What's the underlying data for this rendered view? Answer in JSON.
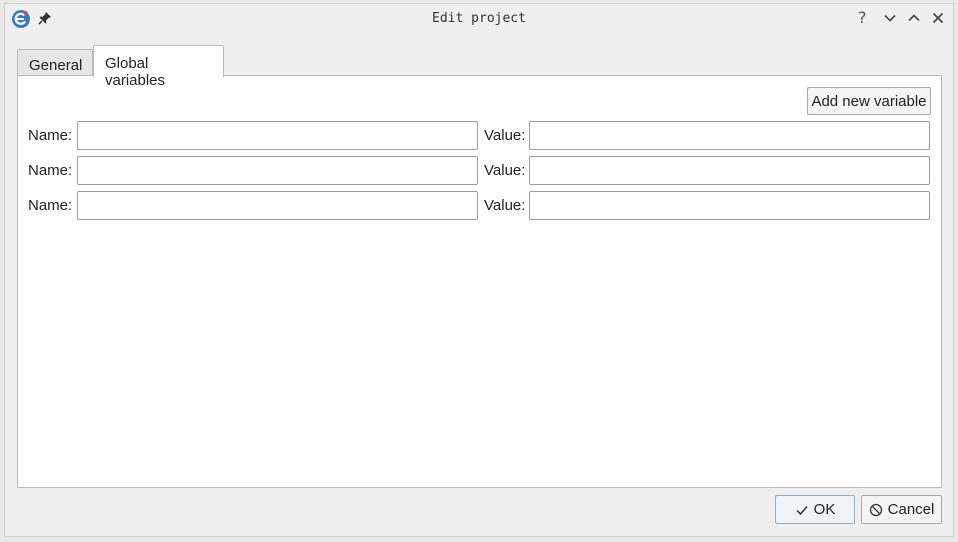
{
  "window": {
    "title": "Edit project",
    "help_label": "?"
  },
  "tabs": [
    {
      "label": "General"
    },
    {
      "label": "Global variables"
    }
  ],
  "global_variables": {
    "add_button_label": "Add new variable",
    "name_label": "Name:",
    "value_label": "Value:",
    "rows": [
      {
        "name": "",
        "value": ""
      },
      {
        "name": "",
        "value": ""
      },
      {
        "name": "",
        "value": ""
      }
    ]
  },
  "footer": {
    "ok_label": "OK",
    "cancel_label": "Cancel"
  },
  "colors": {
    "app_icon_blue": "#3a79c9",
    "ok_border": "#8fb1cf"
  },
  "icons": [
    "app-icon",
    "pin-icon",
    "chevron-down-icon",
    "chevron-up-icon",
    "close-icon",
    "check-icon",
    "cancel-icon"
  ]
}
